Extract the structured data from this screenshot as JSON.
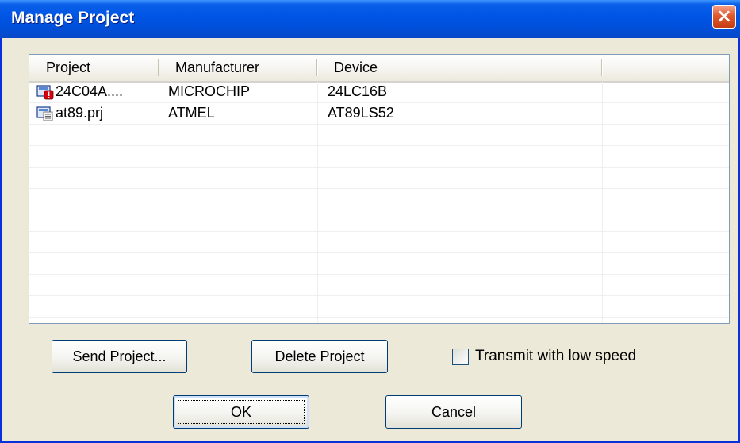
{
  "window": {
    "title": "Manage Project",
    "close_label": "×"
  },
  "list": {
    "columns": [
      "Project",
      "Manufacturer",
      "Device"
    ],
    "rows": [
      {
        "project": "24C04A....",
        "manufacturer": "MICROCHIP",
        "device": "24LC16B",
        "icon": "project-warning-icon"
      },
      {
        "project": "at89.prj",
        "manufacturer": "ATMEL",
        "device": "AT89LS52",
        "icon": "project-file-icon"
      }
    ]
  },
  "buttons": {
    "send_project": "Send Project...",
    "delete_project": "Delete Project",
    "ok": "OK",
    "cancel": "Cancel"
  },
  "options": {
    "transmit_low_speed_label": "Transmit with low speed",
    "transmit_low_speed_checked": false
  },
  "colors": {
    "titlebar": "#0055e5",
    "window_bg": "#ece9d8",
    "close_button": "#e0592e",
    "list_border": "#7f9db9"
  }
}
